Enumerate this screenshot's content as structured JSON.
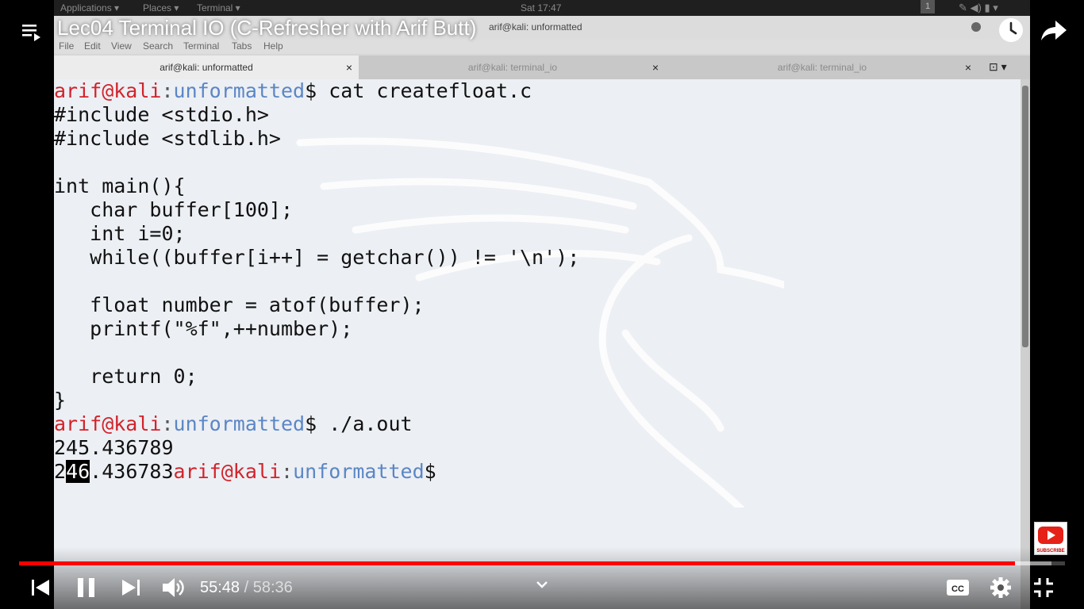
{
  "video": {
    "title": "Lec04 Terminal IO (C-Refresher with Arif Butt)",
    "current_time": "55:48",
    "separator": " / ",
    "duration": "58:36",
    "progress_played": 0.952,
    "progress_buffered": 0.987
  },
  "desktop": {
    "topbar": {
      "applications": "Applications ▾",
      "places": "Places ▾",
      "terminal": "Terminal ▾",
      "clock": "Sat 17:47",
      "workspace": "1"
    },
    "window_title": "arif@kali: unformatted",
    "menu": [
      "File",
      "Edit",
      "View",
      "Search",
      "Terminal",
      "Tabs",
      "Help"
    ],
    "tabs": [
      {
        "label": "arif@kali: unformatted",
        "active": true
      },
      {
        "label": "arif@kali: terminal_io",
        "active": false
      },
      {
        "label": "arif@kali: terminal_io",
        "active": false
      }
    ]
  },
  "terminal": {
    "user_host": "arif@kali",
    "colon": ":",
    "dir": "unformatted",
    "prompt_symbol": "$",
    "cmd1": " cat createfloat.c",
    "code": [
      "#include <stdio.h>",
      "#include <stdlib.h>",
      "",
      "int main(){",
      "   char buffer[100];",
      "   int i=0;",
      "   while((buffer[i++] = getchar()) != '\\n');",
      "",
      "   float number = atof(buffer);",
      "   printf(\"%f\",++number);",
      "",
      "   return 0;",
      "}"
    ],
    "cmd2": " ./a.out",
    "output1": "245.436789",
    "output2_a": "2",
    "output2_hl": "46",
    "output2_b": ".436783"
  },
  "icons": {
    "playlist": "playlist-icon",
    "watch_later": "clock-icon",
    "share": "share-arrow-icon",
    "previous": "skip-previous-icon",
    "pause": "pause-icon",
    "next": "skip-next-icon",
    "volume": "volume-icon",
    "chapters": "chevron-down-icon",
    "captions": "cc-icon",
    "settings": "gear-icon",
    "exit_fullscreen": "exit-fullscreen-icon"
  },
  "colors": {
    "progress": "#ff0000",
    "prompt_user": "#d2232c",
    "prompt_dir": "#5b86c6"
  }
}
